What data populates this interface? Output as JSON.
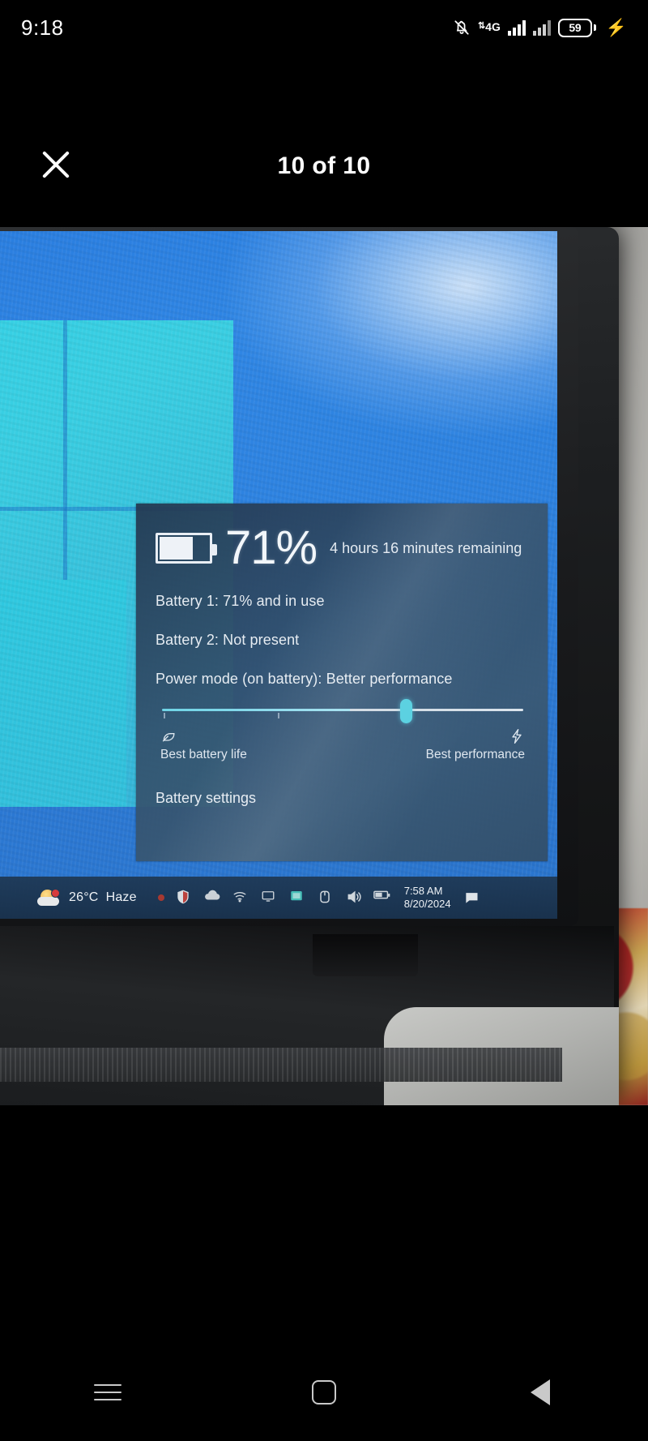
{
  "status_bar": {
    "time": "9:18",
    "network_type": "4G",
    "battery_percent": "59",
    "icons": [
      "bell-off-icon",
      "signal-bars-icon",
      "signal-bars-secondary-icon",
      "battery-icon",
      "charging-bolt-icon"
    ]
  },
  "viewer": {
    "close_label": "Close",
    "counter": "10 of 10"
  },
  "photo": {
    "subject": "laptop-screen-battery-flyout",
    "flyout": {
      "percent": "71%",
      "remaining": "4 hours 16 minutes remaining",
      "battery1": "Battery 1: 71% and in use",
      "battery2": "Battery 2: Not present",
      "power_mode": "Power mode (on battery): Better performance",
      "slider": {
        "left_label": "Best battery life",
        "right_label": "Best performance",
        "left_icon": "leaf-icon",
        "right_icon": "lightning-bolt-icon",
        "value_percent": 66
      },
      "settings_link": "Battery settings"
    },
    "taskbar": {
      "weather_temp": "26°C",
      "weather_condition": "Haze",
      "time": "7:58 AM",
      "date": "8/20/2024",
      "tray_icons": [
        "red-dot-icon",
        "security-shield-icon",
        "onedrive-cloud-icon",
        "wifi-icon",
        "display-icon",
        "graphics-icon",
        "touchpad-icon",
        "volume-icon",
        "battery-tray-icon"
      ],
      "notification_icon": "action-center-icon"
    }
  },
  "nav_bar": {
    "recents_label": "Recents",
    "home_label": "Home",
    "back_label": "Back"
  },
  "colors": {
    "accent_teal": "#55cfe0",
    "desktop_blue": "#2d82e0",
    "flyout_bg": "#3a5872",
    "nav_icon": "#c9c9c9"
  }
}
